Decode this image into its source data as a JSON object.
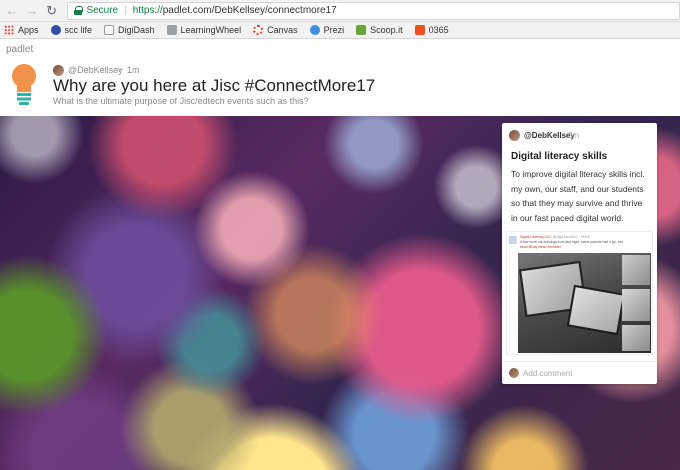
{
  "browser": {
    "back_icon": "back-arrow-icon",
    "forward_icon": "forward-arrow-icon",
    "reload_icon": "reload-icon",
    "secure_label": "Secure",
    "url_protocol": "https://",
    "url_host": "padlet.com/DebKellsey/connectmore17",
    "secure_color": "#0b8043"
  },
  "bookmarks": [
    {
      "label": "Apps",
      "icon": "apps-grid-icon"
    },
    {
      "label": "scc life",
      "icon": "scc-life-icon"
    },
    {
      "label": "DigiDash",
      "icon": "digidash-icon"
    },
    {
      "label": "LearningWheel",
      "icon": "learningwheel-icon"
    },
    {
      "label": "Canvas",
      "icon": "canvas-icon"
    },
    {
      "label": "Prezi",
      "icon": "prezi-icon"
    },
    {
      "label": "Scoop.it",
      "icon": "scoopit-icon"
    },
    {
      "label": "0365",
      "icon": "office365-icon"
    }
  ],
  "wall": {
    "logo": "padlet",
    "icon": "lightbulb-icon",
    "author": "@DebKellsey",
    "separator": "·",
    "time": "1m",
    "title": "Why are you here at Jisc #ConnectMore17",
    "description": "What is the ultimate purpose of Jisc/edtech events such as this?"
  },
  "post": {
    "author": "@DebKellsey",
    "time": "2m",
    "title": "Digital literacy skills",
    "body_lines": [
      "To improve digital literacy skills incl.",
      "my own, our staff, and our students",
      "so that they may survive and thrive",
      "in our fast paced digital world."
    ],
    "embed": {
      "author": "Digital Learning SCC",
      "handle": "@DigiLearnSCC · Feb 8",
      "text": "A few more cat drawings from last night, some parents had a go, too!",
      "hashtags": "#sccLBDay #lead #ereader"
    },
    "comment_placeholder": "Add comment"
  }
}
